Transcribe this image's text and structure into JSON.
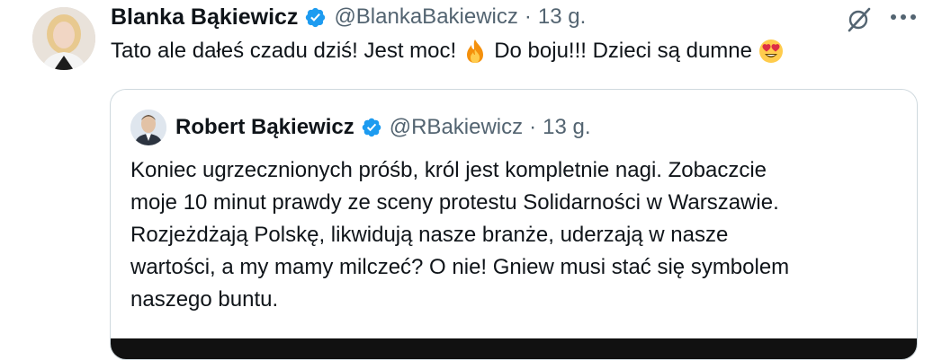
{
  "tweet": {
    "author_name": "Blanka Bąkiewicz",
    "handle": "@BlankaBakiewicz",
    "separator": "·",
    "time": "13 g.",
    "text_part1": "Tato ale dałeś czadu dziś! Jest moc!",
    "emoji1": "fire-emoji",
    "text_part2": "Do boju!!! Dzieci są dumne",
    "emoji2": "heart-eyes-emoji",
    "more_label": "···"
  },
  "quoted": {
    "author_name": "Robert Bąkiewicz",
    "handle": "@RBakiewicz",
    "separator": "·",
    "time": "13 g.",
    "lines": [
      "Koniec ugrzecznionych próśb, król jest kompletnie nagi. Zobaczcie",
      "moje 10 minut prawdy ze sceny protestu Solidarności w Warszawie.",
      "Rozjeżdżają Polskę, likwidują nasze branże, uderzają w nasze",
      "wartości, a my mamy milczeć? O nie! Gniew musi stać się symbolem",
      "naszego buntu."
    ]
  },
  "colors": {
    "verified": "#1d9bf0",
    "secondary_text": "#536471",
    "border": "#cfd9de"
  },
  "icons": [
    "verified-badge-icon",
    "grok-icon",
    "more-icon"
  ]
}
